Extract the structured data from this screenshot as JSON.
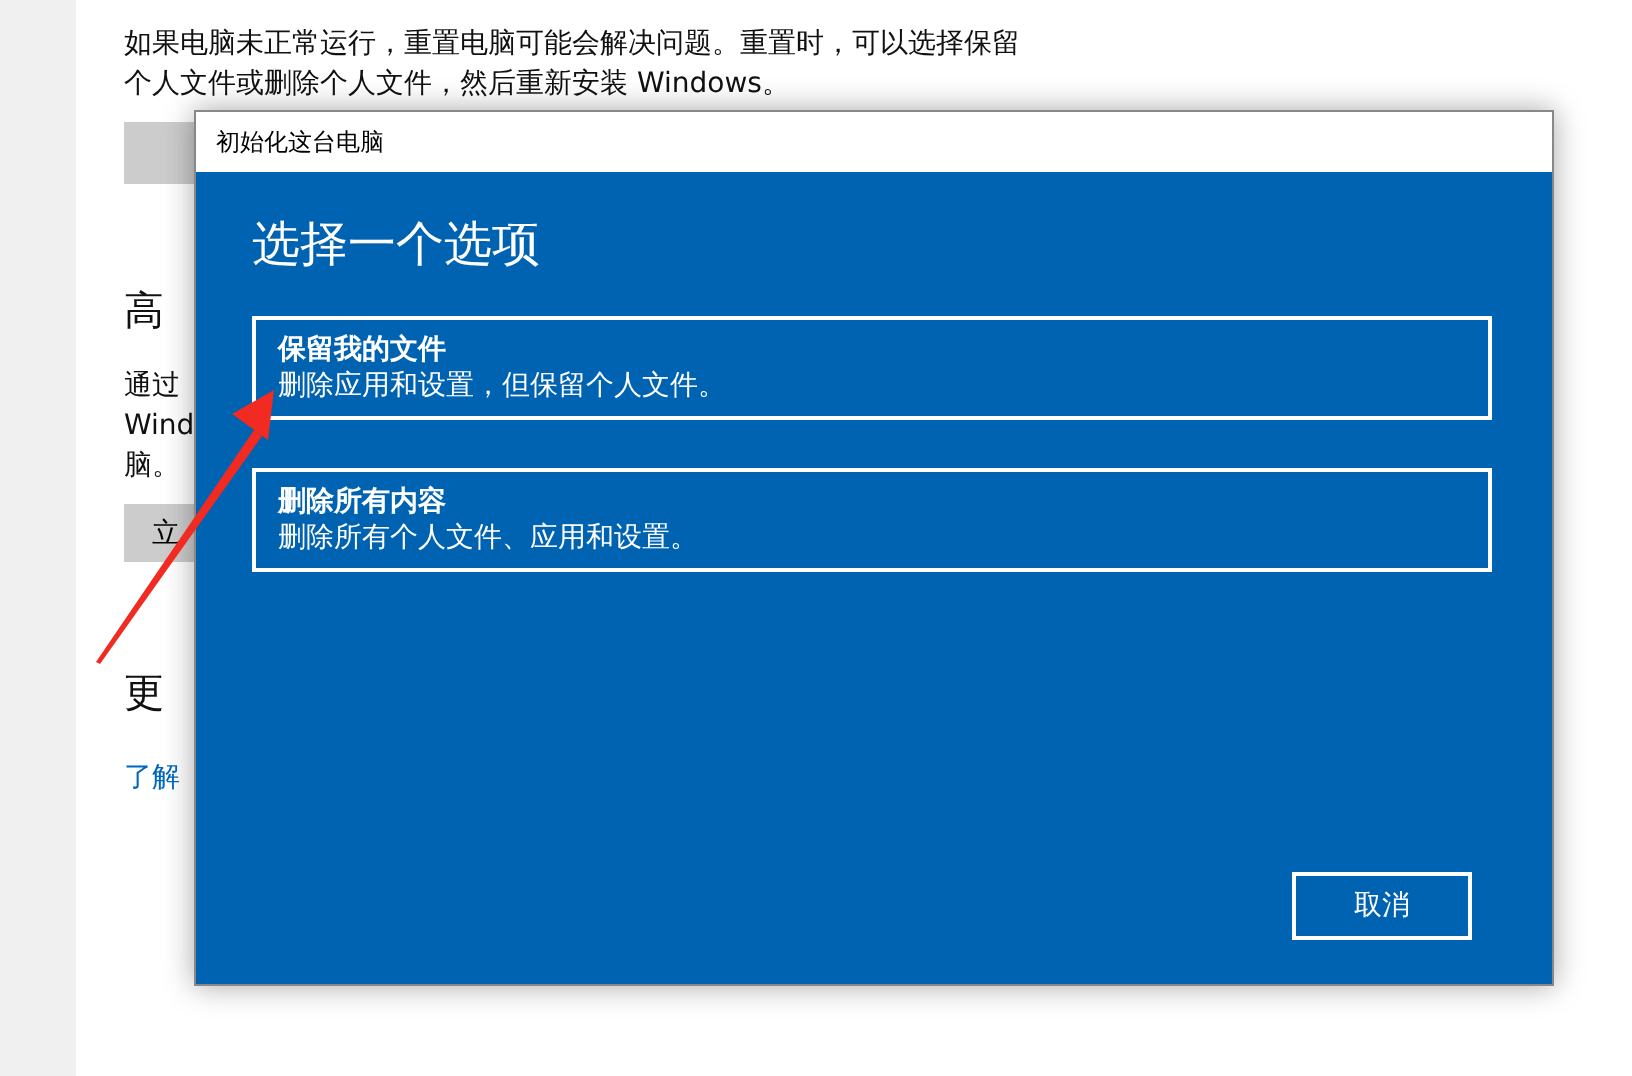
{
  "settings_page": {
    "intro_lines": [
      "如果电脑未正常运行，重置电脑可能会解决问题。重置时，可以选择保留",
      "个人文件或删除个人文件，然后重新安装 Windows。"
    ],
    "advanced_heading": "高",
    "advanced_lines": [
      "通过",
      "Wind",
      "脑。"
    ],
    "start_button": "立",
    "more_heading": "更",
    "link": "了解"
  },
  "dialog": {
    "title": "初始化这台电脑",
    "heading": "选择一个选项",
    "options": [
      {
        "title": "保留我的文件",
        "description": "删除应用和设置，但保留个人文件。"
      },
      {
        "title": "删除所有内容",
        "description": "删除所有个人文件、应用和设置。"
      }
    ],
    "cancel_button": "取消"
  }
}
